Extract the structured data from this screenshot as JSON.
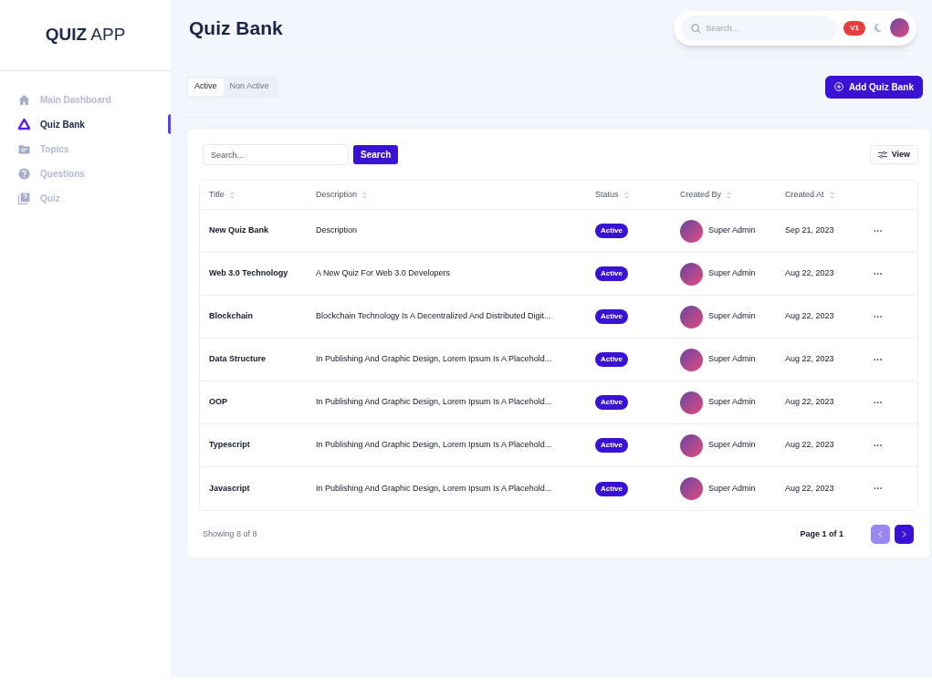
{
  "logo": {
    "bold": "QUIZ",
    "light": "APP"
  },
  "sidebar": {
    "items": [
      {
        "label": "Main Dashboard",
        "selected": false
      },
      {
        "label": "Quiz Bank",
        "selected": true
      },
      {
        "label": "Topics",
        "selected": false
      },
      {
        "label": "Questions",
        "selected": false
      },
      {
        "label": "Quiz",
        "selected": false
      }
    ]
  },
  "header": {
    "title": "Quiz Bank",
    "search_placeholder": "Search...",
    "badge": "V1"
  },
  "tabs": [
    {
      "label": "Active",
      "selected": true
    },
    {
      "label": "Non Active",
      "selected": false
    }
  ],
  "add_button": "Add Quiz Bank",
  "table_search": {
    "placeholder": "Search...",
    "button": "Search"
  },
  "view_button": "View",
  "table": {
    "columns": [
      "Title",
      "Description",
      "Status",
      "Created By",
      "Created At"
    ],
    "rows": [
      {
        "title": "New Quiz Bank",
        "description": "Description",
        "status": "Active",
        "created_by": "Super Admin",
        "created_at": "Sep 21, 2023",
        "menu": "···"
      },
      {
        "title": "Web 3.0 Technology",
        "description": "A New Quiz For Web 3.0 Developers",
        "status": "Active",
        "created_by": "Super Admin",
        "created_at": "Aug 22, 2023",
        "menu": "···"
      },
      {
        "title": "Blockchain",
        "description": "Blockchain Technology Is A Decentralized And Distributed Digit...",
        "status": "Active",
        "created_by": "Super Admin",
        "created_at": "Aug 22, 2023",
        "menu": "···"
      },
      {
        "title": "Data Structure",
        "description": "In Publishing And Graphic Design, Lorem Ipsum Is A Placehold...",
        "status": "Active",
        "created_by": "Super Admin",
        "created_at": "Aug 22, 2023",
        "menu": "···"
      },
      {
        "title": "OOP",
        "description": "In Publishing And Graphic Design, Lorem Ipsum Is A Placehold...",
        "status": "Active",
        "created_by": "Super Admin",
        "created_at": "Aug 22, 2023",
        "menu": "···"
      },
      {
        "title": "Typescript",
        "description": "In Publishing And Graphic Design, Lorem Ipsum Is A Placehold...",
        "status": "Active",
        "created_by": "Super Admin",
        "created_at": "Aug 22, 2023",
        "menu": "···"
      },
      {
        "title": "Javascript",
        "description": "In Publishing And Graphic Design, Lorem Ipsum Is A Placehold...",
        "status": "Active",
        "created_by": "Super Admin",
        "created_at": "Aug 22, 2023",
        "menu": "···"
      }
    ]
  },
  "footer": {
    "showing": "Showing 8 of 8",
    "page": "Page 1 of 1",
    "prev_disabled": true,
    "next_disabled": false
  }
}
